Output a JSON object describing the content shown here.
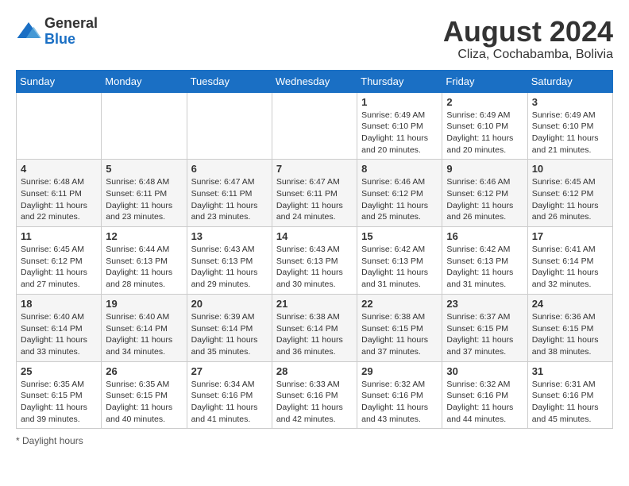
{
  "header": {
    "logo_general": "General",
    "logo_blue": "Blue",
    "month_title": "August 2024",
    "location": "Cliza, Cochabamba, Bolivia"
  },
  "days_of_week": [
    "Sunday",
    "Monday",
    "Tuesday",
    "Wednesday",
    "Thursday",
    "Friday",
    "Saturday"
  ],
  "footer": {
    "daylight_label": "Daylight hours"
  },
  "weeks": [
    [
      {
        "day": "",
        "info": ""
      },
      {
        "day": "",
        "info": ""
      },
      {
        "day": "",
        "info": ""
      },
      {
        "day": "",
        "info": ""
      },
      {
        "day": "1",
        "info": "Sunrise: 6:49 AM\nSunset: 6:10 PM\nDaylight: 11 hours\nand 20 minutes."
      },
      {
        "day": "2",
        "info": "Sunrise: 6:49 AM\nSunset: 6:10 PM\nDaylight: 11 hours\nand 20 minutes."
      },
      {
        "day": "3",
        "info": "Sunrise: 6:49 AM\nSunset: 6:10 PM\nDaylight: 11 hours\nand 21 minutes."
      }
    ],
    [
      {
        "day": "4",
        "info": "Sunrise: 6:48 AM\nSunset: 6:11 PM\nDaylight: 11 hours\nand 22 minutes."
      },
      {
        "day": "5",
        "info": "Sunrise: 6:48 AM\nSunset: 6:11 PM\nDaylight: 11 hours\nand 23 minutes."
      },
      {
        "day": "6",
        "info": "Sunrise: 6:47 AM\nSunset: 6:11 PM\nDaylight: 11 hours\nand 23 minutes."
      },
      {
        "day": "7",
        "info": "Sunrise: 6:47 AM\nSunset: 6:11 PM\nDaylight: 11 hours\nand 24 minutes."
      },
      {
        "day": "8",
        "info": "Sunrise: 6:46 AM\nSunset: 6:12 PM\nDaylight: 11 hours\nand 25 minutes."
      },
      {
        "day": "9",
        "info": "Sunrise: 6:46 AM\nSunset: 6:12 PM\nDaylight: 11 hours\nand 26 minutes."
      },
      {
        "day": "10",
        "info": "Sunrise: 6:45 AM\nSunset: 6:12 PM\nDaylight: 11 hours\nand 26 minutes."
      }
    ],
    [
      {
        "day": "11",
        "info": "Sunrise: 6:45 AM\nSunset: 6:12 PM\nDaylight: 11 hours\nand 27 minutes."
      },
      {
        "day": "12",
        "info": "Sunrise: 6:44 AM\nSunset: 6:13 PM\nDaylight: 11 hours\nand 28 minutes."
      },
      {
        "day": "13",
        "info": "Sunrise: 6:43 AM\nSunset: 6:13 PM\nDaylight: 11 hours\nand 29 minutes."
      },
      {
        "day": "14",
        "info": "Sunrise: 6:43 AM\nSunset: 6:13 PM\nDaylight: 11 hours\nand 30 minutes."
      },
      {
        "day": "15",
        "info": "Sunrise: 6:42 AM\nSunset: 6:13 PM\nDaylight: 11 hours\nand 31 minutes."
      },
      {
        "day": "16",
        "info": "Sunrise: 6:42 AM\nSunset: 6:13 PM\nDaylight: 11 hours\nand 31 minutes."
      },
      {
        "day": "17",
        "info": "Sunrise: 6:41 AM\nSunset: 6:14 PM\nDaylight: 11 hours\nand 32 minutes."
      }
    ],
    [
      {
        "day": "18",
        "info": "Sunrise: 6:40 AM\nSunset: 6:14 PM\nDaylight: 11 hours\nand 33 minutes."
      },
      {
        "day": "19",
        "info": "Sunrise: 6:40 AM\nSunset: 6:14 PM\nDaylight: 11 hours\nand 34 minutes."
      },
      {
        "day": "20",
        "info": "Sunrise: 6:39 AM\nSunset: 6:14 PM\nDaylight: 11 hours\nand 35 minutes."
      },
      {
        "day": "21",
        "info": "Sunrise: 6:38 AM\nSunset: 6:14 PM\nDaylight: 11 hours\nand 36 minutes."
      },
      {
        "day": "22",
        "info": "Sunrise: 6:38 AM\nSunset: 6:15 PM\nDaylight: 11 hours\nand 37 minutes."
      },
      {
        "day": "23",
        "info": "Sunrise: 6:37 AM\nSunset: 6:15 PM\nDaylight: 11 hours\nand 37 minutes."
      },
      {
        "day": "24",
        "info": "Sunrise: 6:36 AM\nSunset: 6:15 PM\nDaylight: 11 hours\nand 38 minutes."
      }
    ],
    [
      {
        "day": "25",
        "info": "Sunrise: 6:35 AM\nSunset: 6:15 PM\nDaylight: 11 hours\nand 39 minutes."
      },
      {
        "day": "26",
        "info": "Sunrise: 6:35 AM\nSunset: 6:15 PM\nDaylight: 11 hours\nand 40 minutes."
      },
      {
        "day": "27",
        "info": "Sunrise: 6:34 AM\nSunset: 6:16 PM\nDaylight: 11 hours\nand 41 minutes."
      },
      {
        "day": "28",
        "info": "Sunrise: 6:33 AM\nSunset: 6:16 PM\nDaylight: 11 hours\nand 42 minutes."
      },
      {
        "day": "29",
        "info": "Sunrise: 6:32 AM\nSunset: 6:16 PM\nDaylight: 11 hours\nand 43 minutes."
      },
      {
        "day": "30",
        "info": "Sunrise: 6:32 AM\nSunset: 6:16 PM\nDaylight: 11 hours\nand 44 minutes."
      },
      {
        "day": "31",
        "info": "Sunrise: 6:31 AM\nSunset: 6:16 PM\nDaylight: 11 hours\nand 45 minutes."
      }
    ]
  ]
}
